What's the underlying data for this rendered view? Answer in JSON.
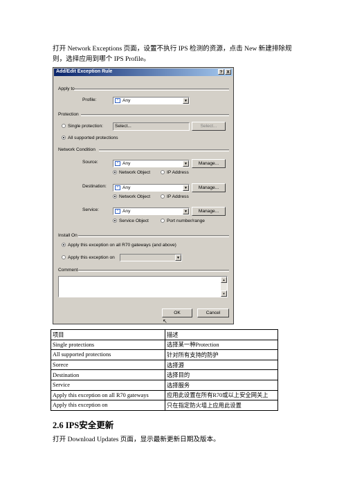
{
  "intro": "打开 Network Exceptions 页面，设置不执行 IPS 检测的资源，点击 New 新建排除规则，选择应用到哪个 IPS Profile。",
  "dialog": {
    "title": "Add/Edit Exception Rule",
    "help_label": "?",
    "close_label": "X",
    "apply_to": {
      "section": "Apply to",
      "profile_label": "Profile:",
      "profile_value": "Any"
    },
    "protection": {
      "section": "Protection",
      "single_label": "Single protection:",
      "single_value": "Select...",
      "select_button": "Select...",
      "all_label": "All supported protections"
    },
    "network_condition": {
      "section": "Network Condition",
      "source_label": "Source:",
      "source_value": "Any",
      "destination_label": "Destination:",
      "destination_value": "Any",
      "service_label": "Service:",
      "service_value": "Any",
      "manage_label": "Manage...",
      "network_object": "Network Object",
      "ip_address": "IP Address",
      "service_object": "Service Object",
      "port_number": "Port number/range"
    },
    "install_on": {
      "section": "Install On",
      "apply_all": "Apply this exception on all R70 gateways (and above)",
      "apply_on": "Apply this exception on"
    },
    "comment": {
      "section": "Comment"
    },
    "ok_label": "OK",
    "cancel_label": "Cancel"
  },
  "table": {
    "headers": [
      "项目",
      "描述"
    ],
    "rows": [
      [
        "Single protections",
        "选择某一种Protection"
      ],
      [
        "All supported protections",
        "针对所有支持的防护"
      ],
      [
        "Sorece",
        "选择源"
      ],
      [
        "Destination",
        "选择目的"
      ],
      [
        "Service",
        "选择服务"
      ],
      [
        "Apply this exception on all R70 gateways",
        "应用此设置在所有R70或以上安全网关上"
      ],
      [
        "Apply this exception on",
        "只在指定防火墙上应用此设置"
      ]
    ]
  },
  "section_heading": "2.6 IPS安全更新",
  "outro": "打开 Download Updates 页面，显示最新更新日期及版本。"
}
